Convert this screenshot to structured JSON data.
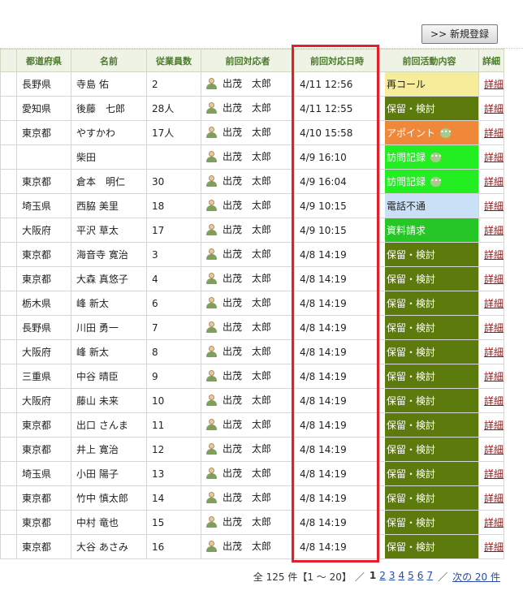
{
  "toolbar": {
    "new_label": ">> 新規登録"
  },
  "headers": [
    "都道府県",
    "名前",
    "従業員数",
    "前回対応者",
    "前回対応日時",
    "前回活動内容",
    "詳細"
  ],
  "colors": {
    "再コール": "#f6ec99",
    "保留・検討": "#5d7a0c",
    "アポイント": "#f0883a",
    "訪問記録": "#22ee22",
    "電話不通": "#c9e0f7",
    "資料請求": "#26c626"
  },
  "rows": [
    {
      "pref": "長野県",
      "name": "寺島 佑",
      "emp": "2",
      "staff": "出茂　太郎",
      "date": "4/11 12:56",
      "act": "再コール",
      "chat": false,
      "detail": "詳細"
    },
    {
      "pref": "愛知県",
      "name": "後藤　七郎",
      "emp": "28人",
      "staff": "出茂　太郎",
      "date": "4/11 12:55",
      "act": "保留・検討",
      "chat": false,
      "detail": "詳細"
    },
    {
      "pref": "東京都",
      "name": "やすかわ",
      "emp": "17人",
      "staff": "出茂　太郎",
      "date": "4/10 15:58",
      "act": "アポイント",
      "chat": true,
      "detail": "詳細"
    },
    {
      "pref": "",
      "name": "柴田",
      "emp": "",
      "staff": "出茂　太郎",
      "date": "4/9 16:10",
      "act": "訪問記録",
      "chat": true,
      "detail": "詳細"
    },
    {
      "pref": "東京都",
      "name": "倉本　明仁",
      "emp": "30",
      "staff": "出茂　太郎",
      "date": "4/9 16:04",
      "act": "訪問記録",
      "chat": true,
      "detail": "詳細"
    },
    {
      "pref": "埼玉県",
      "name": "西脇 美里",
      "emp": "18",
      "staff": "出茂　太郎",
      "date": "4/9 10:15",
      "act": "電話不通",
      "chat": false,
      "detail": "詳細"
    },
    {
      "pref": "大阪府",
      "name": "平沢 草太",
      "emp": "17",
      "staff": "出茂　太郎",
      "date": "4/9 10:15",
      "act": "資料請求",
      "chat": false,
      "detail": "詳細"
    },
    {
      "pref": "東京都",
      "name": "海音寺 寛治",
      "emp": "3",
      "staff": "出茂　太郎",
      "date": "4/8 14:19",
      "act": "保留・検討",
      "chat": false,
      "detail": "詳細"
    },
    {
      "pref": "東京都",
      "name": "大森 真悠子",
      "emp": "4",
      "staff": "出茂　太郎",
      "date": "4/8 14:19",
      "act": "保留・検討",
      "chat": false,
      "detail": "詳細"
    },
    {
      "pref": "栃木県",
      "name": "峰 新太",
      "emp": "6",
      "staff": "出茂　太郎",
      "date": "4/8 14:19",
      "act": "保留・検討",
      "chat": false,
      "detail": "詳細"
    },
    {
      "pref": "長野県",
      "name": "川田 勇一",
      "emp": "7",
      "staff": "出茂　太郎",
      "date": "4/8 14:19",
      "act": "保留・検討",
      "chat": false,
      "detail": "詳細"
    },
    {
      "pref": "大阪府",
      "name": "峰 新太",
      "emp": "8",
      "staff": "出茂　太郎",
      "date": "4/8 14:19",
      "act": "保留・検討",
      "chat": false,
      "detail": "詳細"
    },
    {
      "pref": "三重県",
      "name": "中谷 晴臣",
      "emp": "9",
      "staff": "出茂　太郎",
      "date": "4/8 14:19",
      "act": "保留・検討",
      "chat": false,
      "detail": "詳細"
    },
    {
      "pref": "大阪府",
      "name": "藤山 未来",
      "emp": "10",
      "staff": "出茂　太郎",
      "date": "4/8 14:19",
      "act": "保留・検討",
      "chat": false,
      "detail": "詳細"
    },
    {
      "pref": "東京都",
      "name": "出口 さんま",
      "emp": "11",
      "staff": "出茂　太郎",
      "date": "4/8 14:19",
      "act": "保留・検討",
      "chat": false,
      "detail": "詳細"
    },
    {
      "pref": "東京都",
      "name": "井上 寛治",
      "emp": "12",
      "staff": "出茂　太郎",
      "date": "4/8 14:19",
      "act": "保留・検討",
      "chat": false,
      "detail": "詳細"
    },
    {
      "pref": "埼玉県",
      "name": "小田 陽子",
      "emp": "13",
      "staff": "出茂　太郎",
      "date": "4/8 14:19",
      "act": "保留・検討",
      "chat": false,
      "detail": "詳細"
    },
    {
      "pref": "東京都",
      "name": "竹中 慎太郎",
      "emp": "14",
      "staff": "出茂　太郎",
      "date": "4/8 14:19",
      "act": "保留・検討",
      "chat": false,
      "detail": "詳細"
    },
    {
      "pref": "東京都",
      "name": "中村 竜也",
      "emp": "15",
      "staff": "出茂　太郎",
      "date": "4/8 14:19",
      "act": "保留・検討",
      "chat": false,
      "detail": "詳細"
    },
    {
      "pref": "東京都",
      "name": "大谷 あさみ",
      "emp": "16",
      "staff": "出茂　太郎",
      "date": "4/8 14:19",
      "act": "保留・検討",
      "chat": false,
      "detail": "詳細"
    }
  ],
  "pager": {
    "summary": "全 125 件【1 ～ 20】",
    "sep": "／",
    "current": "1",
    "pages": [
      "2",
      "3",
      "4",
      "5",
      "6",
      "7"
    ],
    "next": "次の 20 件"
  }
}
